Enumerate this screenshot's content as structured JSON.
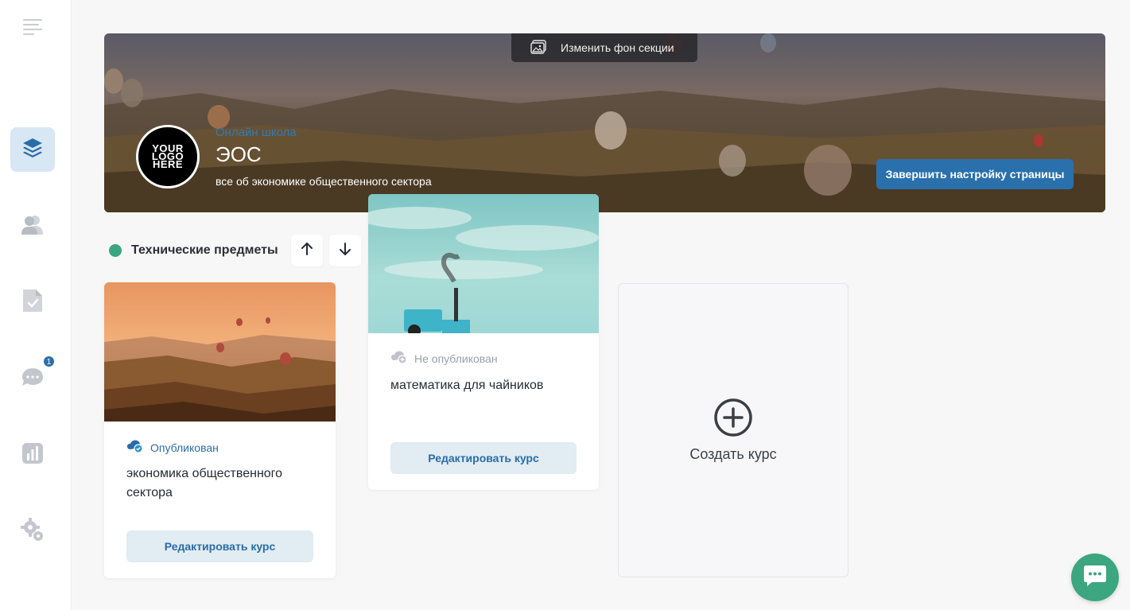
{
  "sidebar": {
    "items": [
      {
        "name": "menu-icon"
      },
      {
        "name": "courses-icon",
        "active": true
      },
      {
        "name": "users-icon"
      },
      {
        "name": "tasks-icon"
      },
      {
        "name": "messages-icon",
        "badge": "1"
      },
      {
        "name": "analytics-icon"
      },
      {
        "name": "settings-icon"
      }
    ]
  },
  "banner": {
    "change_bg_label": "Изменить фон секции",
    "logo_lines": [
      "YOUR",
      "LOGO",
      "HERE"
    ],
    "school_label": "Онлайн школа",
    "school_name": "ЭОС",
    "school_desc": "все об экономике общественного сектора",
    "finish_button": "Завершить настройку страницы"
  },
  "section": {
    "title": "Технические предметы",
    "status_color": "#3ba680"
  },
  "courses": [
    {
      "status": "Опубликован",
      "status_color": "#2a6da6",
      "title": "экономика общественного сектора",
      "edit_label": "Редактировать курс"
    },
    {
      "status": "Не опубликован",
      "status_color": "#9aa0a8",
      "title": "математика для чайников",
      "edit_label": "Редактировать курс"
    }
  ],
  "create_course": {
    "label": "Создать курс"
  },
  "colors": {
    "accent": "#2a70ad",
    "active_bg": "#d7e7f3",
    "green": "#3ba680"
  }
}
